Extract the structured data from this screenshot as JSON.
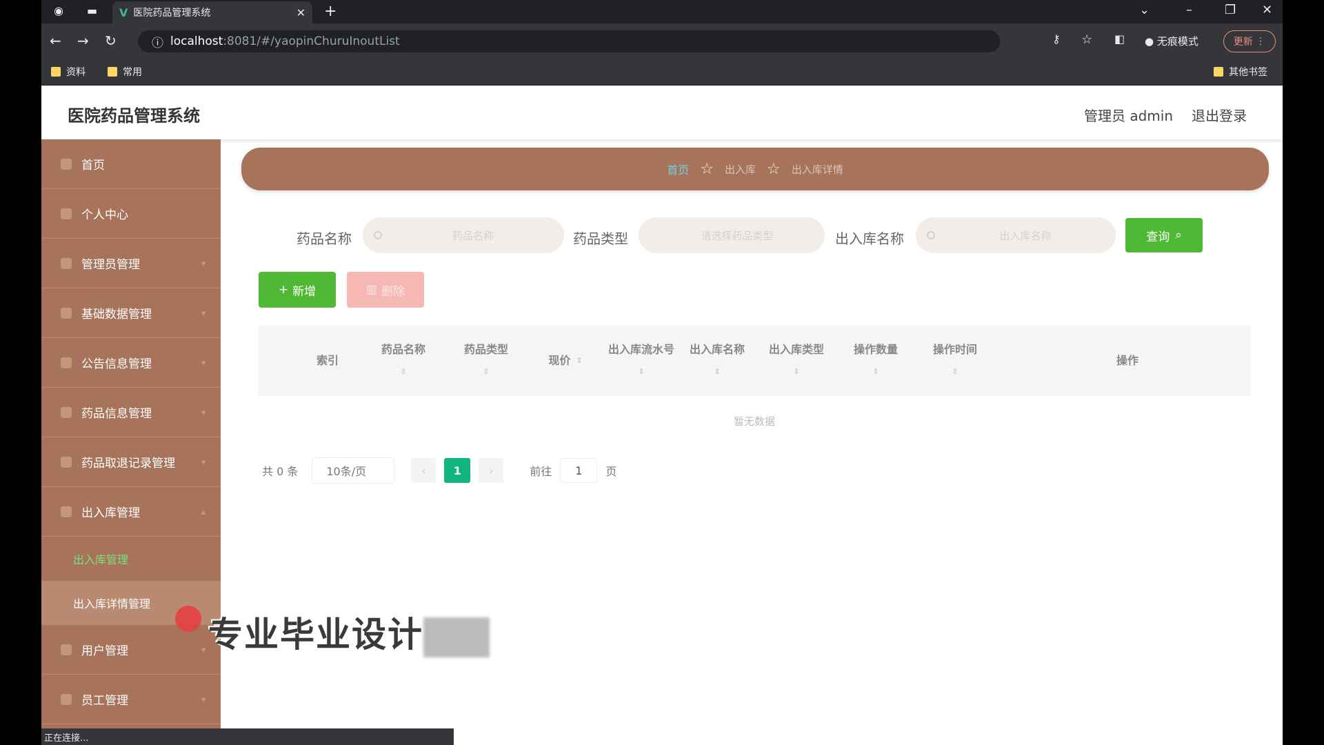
{
  "browser": {
    "tab_title": "医院药品管理系统",
    "url_host": "localhost",
    "url_path": ":8081/#/yaopinChuruInoutList",
    "incognito_label": "无痕模式",
    "update_label": "更新",
    "bookmarks": [
      "资料",
      "常用"
    ],
    "other_bookmarks": "其他书签",
    "status_text": "正在连接..."
  },
  "header": {
    "title": "医院药品管理系统",
    "admin": "管理员 admin",
    "logout": "退出登录"
  },
  "sidebar": {
    "items": [
      {
        "label": "首页"
      },
      {
        "label": "个人中心"
      },
      {
        "label": "管理员管理"
      },
      {
        "label": "基础数据管理"
      },
      {
        "label": "公告信息管理"
      },
      {
        "label": "药品信息管理"
      },
      {
        "label": "药品取退记录管理"
      },
      {
        "label": "出入库管理"
      },
      {
        "label": "用户管理"
      },
      {
        "label": "员工管理"
      }
    ],
    "sub_items": [
      {
        "label": "出入库管理",
        "active": true
      },
      {
        "label": "出入库详情管理",
        "active": false
      }
    ]
  },
  "breadcrumb": {
    "home": "首页",
    "level1": "出入库",
    "level2": "出入库详情"
  },
  "search": {
    "drug_name_label": "药品名称",
    "drug_name_placeholder": "药品名称",
    "drug_type_label": "药品类型",
    "drug_type_placeholder": "请选择药品类型",
    "inout_name_label": "出入库名称",
    "inout_name_placeholder": "出入库名称",
    "query_label": "查询"
  },
  "actions": {
    "add_label": "新增",
    "delete_label": "删除"
  },
  "table": {
    "columns": [
      "索引",
      "药品名称",
      "药品类型",
      "现价",
      "出入库流水号",
      "出入库名称",
      "出入库类型",
      "操作数量",
      "操作时间",
      "操作"
    ],
    "empty_text": "暂无数据"
  },
  "pagination": {
    "total": "共 0 条",
    "page_size": "10条/页",
    "current_page": "1",
    "goto_label": "前往",
    "goto_value": "1",
    "page_suffix": "页"
  },
  "overlay": {
    "watermark": "专业毕业设计"
  }
}
